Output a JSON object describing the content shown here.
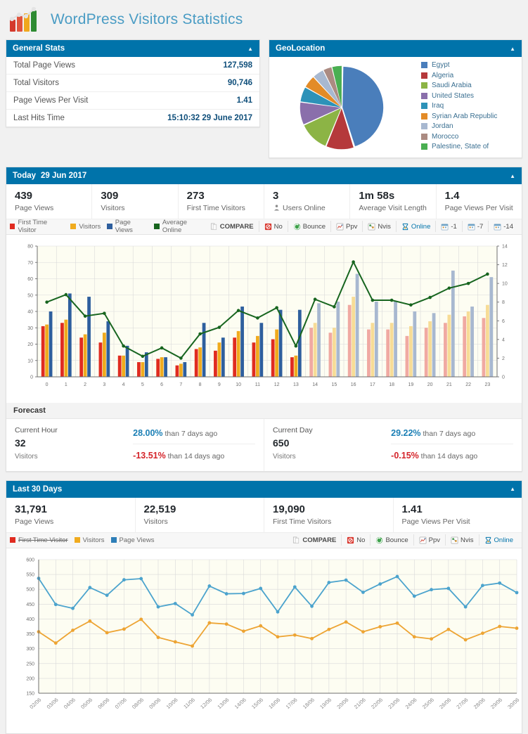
{
  "brand": {
    "title": "WordPress Visitors Statistics",
    "logo_icon": "bar-chart-trend-logo"
  },
  "general_stats": {
    "panel_title": "General Stats",
    "collapse_icon": "caret-up-icon",
    "rows": [
      {
        "label": "Total Page Views",
        "value": "127,598"
      },
      {
        "label": "Total Visitors",
        "value": "90,746"
      },
      {
        "label": "Page Views Per Visit",
        "value": "1.41"
      },
      {
        "label": "Last Hits Time",
        "value": "15:10:32 29 June 2017"
      }
    ]
  },
  "geolocation": {
    "panel_title": "GeoLocation",
    "collapse_icon": "caret-up-icon",
    "chart_data": {
      "type": "pie",
      "title": "GeoLocation",
      "labels": [
        "Egypt",
        "Algeria",
        "Saudi Arabia",
        "United States",
        "Iraq",
        "Syrian Arab Republic",
        "Jordan",
        "Morocco",
        "Palestine, State of"
      ],
      "values": [
        45,
        11,
        12,
        9,
        6,
        5,
        4.5,
        3.5,
        4
      ],
      "colors": [
        "#4a7ebb",
        "#b5393b",
        "#8cb445",
        "#8a6fab",
        "#2d92b8",
        "#e38b27",
        "#a8b8d0",
        "#ab8b82",
        "#4aaf52"
      ],
      "legend_position": "right"
    }
  },
  "today": {
    "panel_title": "Today",
    "panel_date": "29 Jun 2017",
    "collapse_icon": "caret-up-icon",
    "cards": [
      {
        "num": "439",
        "label": "Page Views",
        "icon": ""
      },
      {
        "num": "309",
        "label": "Visitors",
        "icon": ""
      },
      {
        "num": "273",
        "label": "First Time Visitors",
        "icon": ""
      },
      {
        "num": "3",
        "label": "Users Online",
        "icon": "users-online-icon"
      },
      {
        "num": "1m 58s",
        "label": "Average Visit Length",
        "icon": ""
      },
      {
        "num": "1.4",
        "label": "Page Views Per Visit",
        "icon": ""
      }
    ],
    "toolbar": {
      "legend": [
        {
          "label": "First Time Visitor",
          "color": "#e02b20",
          "enabled": true
        },
        {
          "label": "Visitors",
          "color": "#f0ab1e",
          "enabled": true
        },
        {
          "label": "Page Views",
          "color": "#2e5f9e",
          "enabled": true
        },
        {
          "label": "Average Online",
          "color": "#17651f",
          "enabled": true
        }
      ],
      "buttons": [
        {
          "label": "COMPARE",
          "icon": "compare-icon",
          "active": false
        },
        {
          "label": "No",
          "icon": "no-icon",
          "active": false
        },
        {
          "label": "Bounce",
          "icon": "bounce-icon",
          "active": false
        },
        {
          "label": "Ppv",
          "icon": "ppv-icon",
          "active": false
        },
        {
          "label": "Nvis",
          "icon": "nvis-icon",
          "active": false
        },
        {
          "label": "Online",
          "icon": "online-icon",
          "active": true
        },
        {
          "label": "-1",
          "icon": "calendar-icon",
          "active": false
        },
        {
          "label": "-7",
          "icon": "calendar-icon",
          "active": false
        },
        {
          "label": "-14",
          "icon": "calendar-icon",
          "active": false
        }
      ]
    },
    "chart_data": {
      "type": "bar",
      "title": "Today 29 Jun 2017 hourly traffic",
      "xlabel": "",
      "ylabel": "",
      "categories": [
        "0",
        "1",
        "2",
        "3",
        "4",
        "5",
        "6",
        "7",
        "8",
        "9",
        "10",
        "11",
        "12",
        "13",
        "14",
        "15",
        "16",
        "17",
        "18",
        "19",
        "20",
        "21",
        "22",
        "23"
      ],
      "ylim": [
        0,
        80
      ],
      "ytick_step": 10,
      "y2lim": [
        0,
        14
      ],
      "y2tick_step": 2,
      "grid": true,
      "faded_from_index": 14,
      "series": [
        {
          "name": "First Time Visitor",
          "type": "bar",
          "color": "#e02b20",
          "faded_color": "#f0a9a2",
          "values": [
            31,
            33,
            24,
            21,
            13,
            9,
            11,
            7,
            17,
            16,
            24,
            21,
            23,
            12,
            30,
            27,
            44,
            29,
            29,
            25,
            30,
            33,
            37,
            36
          ]
        },
        {
          "name": "Visitors",
          "type": "bar",
          "color": "#f0ab1e",
          "faded_color": "#f7dc96",
          "values": [
            32,
            35,
            26,
            27,
            13,
            9,
            12,
            8,
            18,
            21,
            28,
            25,
            29,
            13,
            33,
            30,
            49,
            33,
            33,
            31,
            34,
            38,
            40,
            44
          ]
        },
        {
          "name": "Page Views",
          "type": "bar",
          "color": "#2e5f9e",
          "faded_color": "#a8b8d0",
          "values": [
            40,
            51,
            49,
            34,
            19,
            15,
            12,
            9,
            33,
            24,
            43,
            33,
            41,
            41,
            45,
            46,
            63,
            46,
            46,
            40,
            39,
            65,
            43,
            61
          ]
        },
        {
          "name": "Average Online",
          "type": "line",
          "color": "#17651f",
          "axis": "right",
          "values": [
            8.0,
            8.8,
            6.5,
            6.8,
            3.3,
            2.2,
            3.1,
            2.0,
            4.6,
            5.3,
            7.1,
            6.3,
            7.4,
            3.3,
            8.3,
            7.5,
            12.3,
            8.2,
            8.2,
            7.7,
            8.5,
            9.5,
            10.0,
            11.0
          ]
        }
      ]
    },
    "forecast": {
      "title": "Forecast",
      "blocks": [
        {
          "label": "Current Hour",
          "value": "32",
          "unit": "Visitors",
          "comparisons": [
            {
              "pct": "28.00%",
              "text": "than 7 days ago",
              "direction": "up"
            },
            {
              "pct": "-13.51%",
              "text": "than 14 days ago",
              "direction": "down"
            }
          ]
        },
        {
          "label": "Current Day",
          "value": "650",
          "unit": "Visitors",
          "comparisons": [
            {
              "pct": "29.22%",
              "text": "than 7 days ago",
              "direction": "up"
            },
            {
              "pct": "-0.15%",
              "text": "than 14 days ago",
              "direction": "down"
            }
          ]
        }
      ]
    }
  },
  "last30": {
    "panel_title": "Last 30 Days",
    "collapse_icon": "caret-up-icon",
    "cards": [
      {
        "num": "31,791",
        "label": "Page Views"
      },
      {
        "num": "22,519",
        "label": "Visitors"
      },
      {
        "num": "19,090",
        "label": "First Time Visitors"
      },
      {
        "num": "1.41",
        "label": "Page Views Per Visit"
      }
    ],
    "toolbar": {
      "legend": [
        {
          "label": "First Time Visitor",
          "color": "#e02b20",
          "enabled": false
        },
        {
          "label": "Visitors",
          "color": "#f0ab1e",
          "enabled": true
        },
        {
          "label": "Page Views",
          "color": "#2e7fb8",
          "enabled": true
        }
      ],
      "buttons": [
        {
          "label": "COMPARE",
          "icon": "compare-icon",
          "active": false
        },
        {
          "label": "No",
          "icon": "no-icon",
          "active": false
        },
        {
          "label": "Bounce",
          "icon": "bounce-icon",
          "active": false
        },
        {
          "label": "Ppv",
          "icon": "ppv-icon",
          "active": false
        },
        {
          "label": "Nvis",
          "icon": "nvis-icon",
          "active": false
        },
        {
          "label": "Online",
          "icon": "online-icon",
          "active": true
        }
      ]
    },
    "chart_data": {
      "type": "line",
      "title": "Last 30 Days",
      "xlabel": "",
      "ylabel": "",
      "categories": [
        "02/06",
        "03/06",
        "04/06",
        "05/06",
        "06/06",
        "07/06",
        "08/06",
        "09/06",
        "10/06",
        "11/06",
        "12/06",
        "13/06",
        "14/06",
        "15/06",
        "16/06",
        "17/06",
        "18/06",
        "19/06",
        "20/06",
        "21/06",
        "22/06",
        "23/06",
        "24/06",
        "25/06",
        "26/06",
        "27/06",
        "28/06",
        "29/06",
        "30/06"
      ],
      "ylim": [
        150,
        600
      ],
      "ytick_step": 50,
      "grid": true,
      "series": [
        {
          "name": "Page Views",
          "color": "#4ba3cd",
          "values": [
            537,
            449,
            436,
            506,
            480,
            532,
            536,
            441,
            452,
            414,
            511,
            485,
            486,
            503,
            424,
            508,
            443,
            523,
            531,
            490,
            518,
            543,
            477,
            499,
            503,
            441,
            513,
            521,
            489
          ]
        },
        {
          "name": "Visitors",
          "color": "#eda433",
          "values": [
            357,
            319,
            362,
            393,
            354,
            366,
            399,
            338,
            323,
            309,
            387,
            383,
            359,
            377,
            340,
            346,
            334,
            365,
            390,
            357,
            374,
            386,
            340,
            333,
            365,
            330,
            352,
            375,
            369
          ]
        }
      ]
    }
  }
}
